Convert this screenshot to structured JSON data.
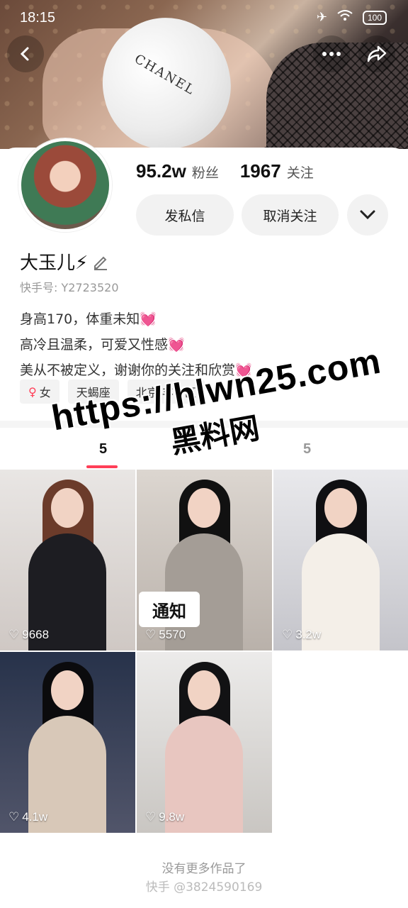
{
  "status_bar": {
    "time": "18:15",
    "battery": "100"
  },
  "profile": {
    "fans_count": "95.2w",
    "fans_label": "粉丝",
    "following_count": "1967",
    "following_label": "关注",
    "message_button": "发私信",
    "unfollow_button": "取消关注",
    "name": "大玉儿⚡",
    "kuaishou_id": "快手号: Y2723520",
    "bio": [
      "身高170，体重未知💓",
      "高冷且温柔，可爱又性感💓",
      "美从不被定义，谢谢你的关注和欣赏💓"
    ],
    "tags": [
      "女",
      "天蝎座",
      "北京 丰台区"
    ]
  },
  "tabs": {
    "works_count": "5",
    "likes_count": "5"
  },
  "videos": [
    {
      "likes": "9668"
    },
    {
      "likes": "5570"
    },
    {
      "likes": "3.2w"
    },
    {
      "likes": "4.1w"
    },
    {
      "likes": "9.8w"
    }
  ],
  "overlay": {
    "notice": "通知",
    "watermark_url": "https://hlwn25.com",
    "watermark_name": "黑料网"
  },
  "footer": {
    "no_more": "没有更多作品了",
    "credit": "快手 @3824590169"
  },
  "colors": {
    "accent": "#ff3e57",
    "bg": "#ffffff",
    "button_bg": "#f2f2f2"
  },
  "icons": [
    "back-icon",
    "more-icon",
    "share-icon",
    "chevron-down-icon",
    "edit-icon",
    "heart-icon",
    "female-icon",
    "airplane-icon",
    "wifi-icon"
  ]
}
